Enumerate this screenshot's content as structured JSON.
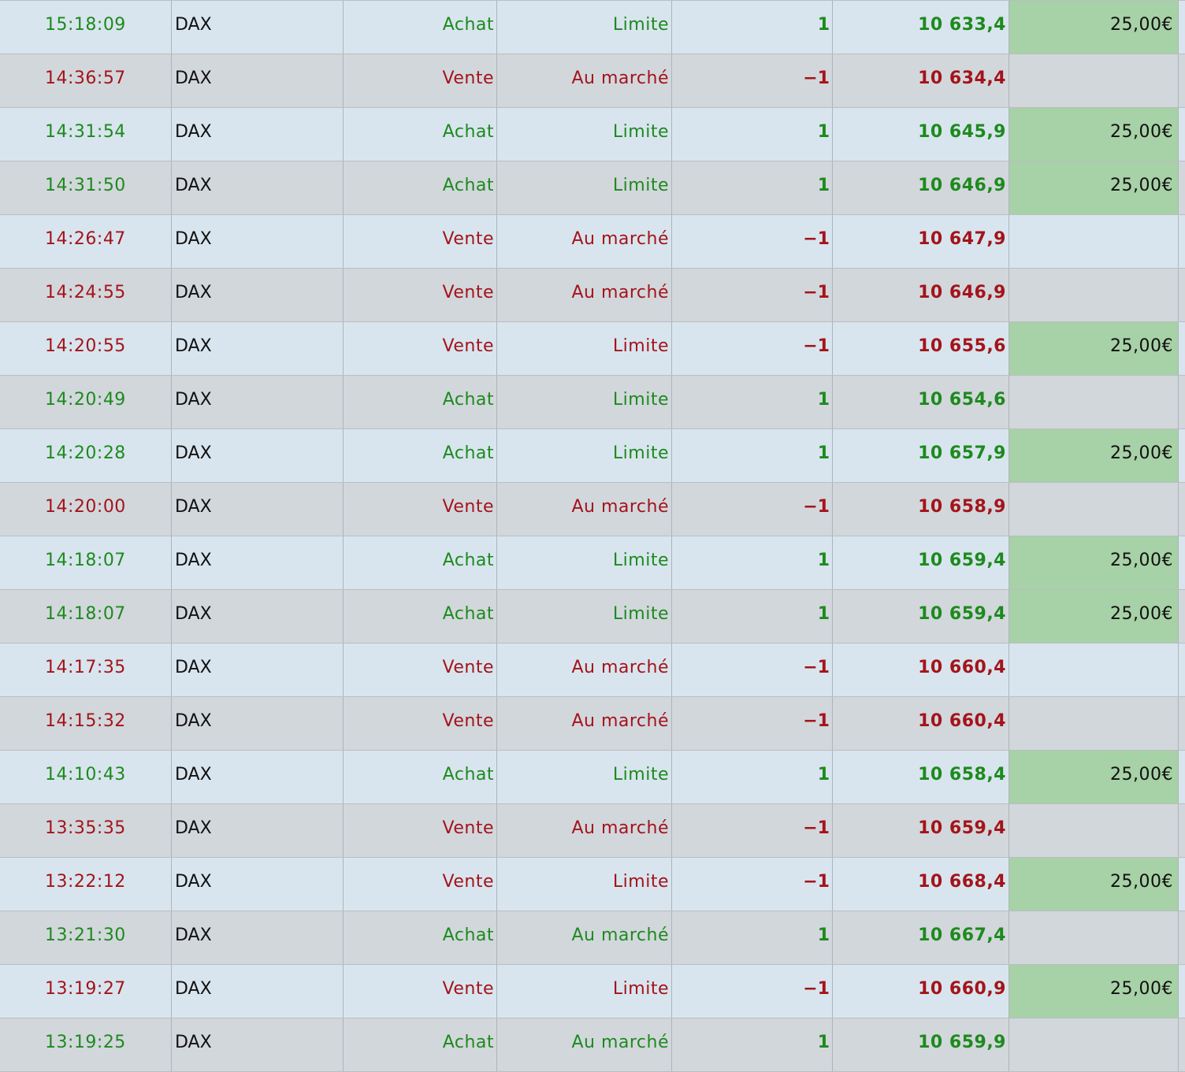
{
  "colors": {
    "buy": "#1d8a1d",
    "sell": "#a3141a",
    "fee_highlight": "#a7d1a6",
    "row_odd": "#d8e5ee",
    "row_even": "#d2d7dc"
  },
  "orders": [
    {
      "time": "15:18:09",
      "instrument": "DAX",
      "side": "Achat",
      "order_type": "Limite",
      "qty": "1",
      "price": "10 633,4",
      "fee": "25,00€",
      "direction": "buy"
    },
    {
      "time": "14:36:57",
      "instrument": "DAX",
      "side": "Vente",
      "order_type": "Au marché",
      "qty": "−1",
      "price": "10 634,4",
      "fee": "",
      "direction": "sell"
    },
    {
      "time": "14:31:54",
      "instrument": "DAX",
      "side": "Achat",
      "order_type": "Limite",
      "qty": "1",
      "price": "10 645,9",
      "fee": "25,00€",
      "direction": "buy"
    },
    {
      "time": "14:31:50",
      "instrument": "DAX",
      "side": "Achat",
      "order_type": "Limite",
      "qty": "1",
      "price": "10 646,9",
      "fee": "25,00€",
      "direction": "buy"
    },
    {
      "time": "14:26:47",
      "instrument": "DAX",
      "side": "Vente",
      "order_type": "Au marché",
      "qty": "−1",
      "price": "10 647,9",
      "fee": "",
      "direction": "sell"
    },
    {
      "time": "14:24:55",
      "instrument": "DAX",
      "side": "Vente",
      "order_type": "Au marché",
      "qty": "−1",
      "price": "10 646,9",
      "fee": "",
      "direction": "sell"
    },
    {
      "time": "14:20:55",
      "instrument": "DAX",
      "side": "Vente",
      "order_type": "Limite",
      "qty": "−1",
      "price": "10 655,6",
      "fee": "25,00€",
      "direction": "sell"
    },
    {
      "time": "14:20:49",
      "instrument": "DAX",
      "side": "Achat",
      "order_type": "Limite",
      "qty": "1",
      "price": "10 654,6",
      "fee": "",
      "direction": "buy"
    },
    {
      "time": "14:20:28",
      "instrument": "DAX",
      "side": "Achat",
      "order_type": "Limite",
      "qty": "1",
      "price": "10 657,9",
      "fee": "25,00€",
      "direction": "buy"
    },
    {
      "time": "14:20:00",
      "instrument": "DAX",
      "side": "Vente",
      "order_type": "Au marché",
      "qty": "−1",
      "price": "10 658,9",
      "fee": "",
      "direction": "sell"
    },
    {
      "time": "14:18:07",
      "instrument": "DAX",
      "side": "Achat",
      "order_type": "Limite",
      "qty": "1",
      "price": "10 659,4",
      "fee": "25,00€",
      "direction": "buy"
    },
    {
      "time": "14:18:07",
      "instrument": "DAX",
      "side": "Achat",
      "order_type": "Limite",
      "qty": "1",
      "price": "10 659,4",
      "fee": "25,00€",
      "direction": "buy"
    },
    {
      "time": "14:17:35",
      "instrument": "DAX",
      "side": "Vente",
      "order_type": "Au marché",
      "qty": "−1",
      "price": "10 660,4",
      "fee": "",
      "direction": "sell"
    },
    {
      "time": "14:15:32",
      "instrument": "DAX",
      "side": "Vente",
      "order_type": "Au marché",
      "qty": "−1",
      "price": "10 660,4",
      "fee": "",
      "direction": "sell"
    },
    {
      "time": "14:10:43",
      "instrument": "DAX",
      "side": "Achat",
      "order_type": "Limite",
      "qty": "1",
      "price": "10 658,4",
      "fee": "25,00€",
      "direction": "buy"
    },
    {
      "time": "13:35:35",
      "instrument": "DAX",
      "side": "Vente",
      "order_type": "Au marché",
      "qty": "−1",
      "price": "10 659,4",
      "fee": "",
      "direction": "sell"
    },
    {
      "time": "13:22:12",
      "instrument": "DAX",
      "side": "Vente",
      "order_type": "Limite",
      "qty": "−1",
      "price": "10 668,4",
      "fee": "25,00€",
      "direction": "sell"
    },
    {
      "time": "13:21:30",
      "instrument": "DAX",
      "side": "Achat",
      "order_type": "Au marché",
      "qty": "1",
      "price": "10 667,4",
      "fee": "",
      "direction": "buy"
    },
    {
      "time": "13:19:27",
      "instrument": "DAX",
      "side": "Vente",
      "order_type": "Limite",
      "qty": "−1",
      "price": "10 660,9",
      "fee": "25,00€",
      "direction": "sell"
    },
    {
      "time": "13:19:25",
      "instrument": "DAX",
      "side": "Achat",
      "order_type": "Au marché",
      "qty": "1",
      "price": "10 659,9",
      "fee": "",
      "direction": "buy"
    }
  ]
}
